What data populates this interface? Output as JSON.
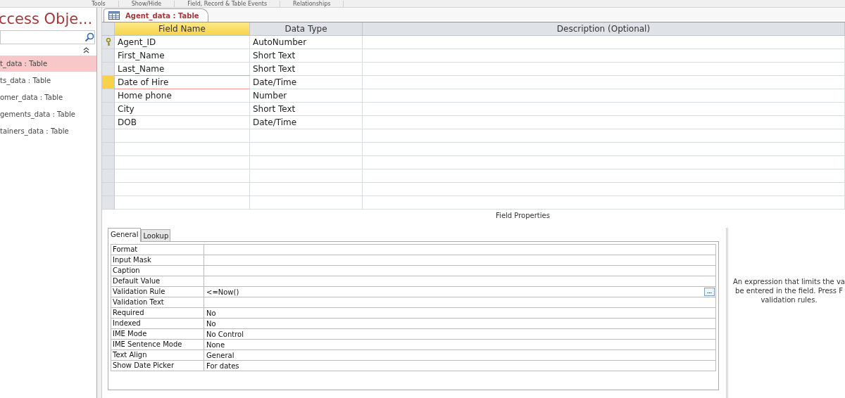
{
  "ribbon": {
    "groups": [
      "Tools",
      "Show/Hide",
      "Field, Record & Table Events",
      "Relationships"
    ]
  },
  "navigation": {
    "title": "ccess Obje...",
    "items": [
      {
        "label": "t_data : Table",
        "selected": true
      },
      {
        "label": "ts_data : Table",
        "selected": false
      },
      {
        "label": "omer_data : Table",
        "selected": false
      },
      {
        "label": "gements_data : Table",
        "selected": false
      },
      {
        "label": "tainers_data : Table",
        "selected": false
      }
    ]
  },
  "document_tab": {
    "label": "Agent_data : Table"
  },
  "table": {
    "columns": [
      "Field Name",
      "Data Type",
      "Description (Optional)"
    ],
    "rows": [
      {
        "field_name": "Agent_ID",
        "data_type": "AutoNumber",
        "primary_key": true,
        "selected": false
      },
      {
        "field_name": "First_Name",
        "data_type": "Short Text",
        "primary_key": false,
        "selected": false
      },
      {
        "field_name": "Last_Name",
        "data_type": "Short Text",
        "primary_key": false,
        "selected": false
      },
      {
        "field_name": "Date of Hire",
        "data_type": "Date/Time",
        "primary_key": false,
        "selected": true
      },
      {
        "field_name": "Home phone",
        "data_type": "Number",
        "primary_key": false,
        "selected": false
      },
      {
        "field_name": "City",
        "data_type": "Short Text",
        "primary_key": false,
        "selected": false
      },
      {
        "field_name": "DOB",
        "data_type": "Date/Time",
        "primary_key": false,
        "selected": false
      }
    ]
  },
  "field_properties": {
    "title": "Field Properties",
    "tabs": [
      {
        "label": "General",
        "selected": true
      },
      {
        "label": "Lookup",
        "selected": false
      }
    ],
    "properties": [
      {
        "label": "Format"
      },
      {
        "label": "Input Mask"
      },
      {
        "label": "Caption"
      },
      {
        "label": "Default Value"
      },
      {
        "label": "Validation Rule",
        "value": "<=Now()",
        "builder": "..."
      },
      {
        "label": "Validation Text"
      },
      {
        "label": "Required",
        "value": "No"
      },
      {
        "label": "Indexed",
        "value": "No"
      },
      {
        "label": "IME Mode",
        "value": "No Control"
      },
      {
        "label": "IME Sentence Mode",
        "value": "None"
      },
      {
        "label": "Text Align",
        "value": "General"
      },
      {
        "label": "Show Date Picker",
        "value": "For dates"
      }
    ],
    "help_lines": [
      "An expression that limits the va",
      "be entered in the field. Press F",
      "validation rules."
    ]
  }
}
